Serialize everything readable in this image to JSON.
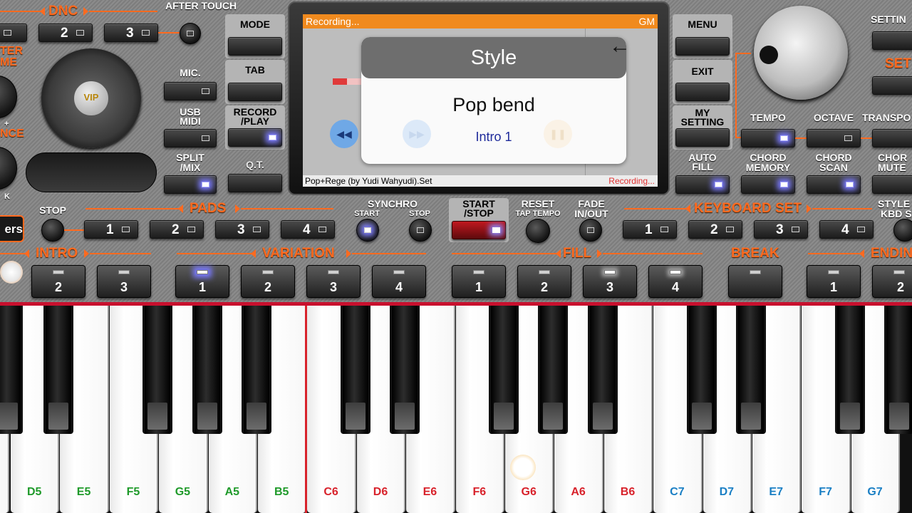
{
  "top_left": {
    "dnc_title": "DNC",
    "dnc_buttons": [
      "2",
      "3"
    ],
    "after_touch": "AFTER TOUCH",
    "side_orange_1": "TER",
    "side_orange_2": "ME",
    "side_orange_3": "NCE",
    "plus_sign": "+",
    "k_letter": "K",
    "vip_text": "VIP",
    "mic": "MIC.",
    "usb_midi_1": "USB",
    "usb_midi_2": "MIDI",
    "split_mix_1": "SPLIT",
    "split_mix_2": "/MIX",
    "ers_label": "ers"
  },
  "center_left_buttons": {
    "mode": "MODE",
    "tab": "TAB",
    "record_1": "RECORD",
    "record_2": "/PLAY",
    "qt": "Q.T."
  },
  "screen": {
    "status": "Recording...",
    "gm": "GM",
    "dialog_title": "Style",
    "style_name": "Pop bend",
    "section": "Intro 1",
    "bottom_file": "Pop+Rege (by Yudi Wahyudi).Set",
    "bottom_status": "Recording..."
  },
  "right_buttons": {
    "menu": "MENU",
    "exit": "EXIT",
    "my_setting_1": "MY",
    "my_setting_2": "SETTING",
    "auto_fill_1": "AUTO",
    "auto_fill_2": "FILL",
    "setting": "SETTIN",
    "set": "SET",
    "tempo": "TEMPO",
    "octave": "OCTAVE",
    "transpose": "TRANSPO",
    "chord_memory_1": "CHORD",
    "chord_memory_2": "MEMORY",
    "chord_scan_1": "CHORD",
    "chord_scan_2": "SCAN",
    "chord_mute_1": "CHOR",
    "chord_mute_2": "MUTE"
  },
  "middle_row": {
    "stop": "STOP",
    "pads": "PADS",
    "pads_buttons": [
      "1",
      "2",
      "3",
      "4"
    ],
    "synchro": "SYNCHRO",
    "synchro_start": "START",
    "synchro_stop": "STOP",
    "start_stop_1": "START",
    "start_stop_2": "/STOP",
    "reset": "RESET",
    "tap_tempo": "TAP TEMPO",
    "fade_1": "FADE",
    "fade_2": "IN/OUT",
    "keyboard_set": "KEYBOARD SET",
    "keyboard_set_buttons": [
      "1",
      "2",
      "3",
      "4"
    ],
    "style_kbd_1": "STYLE",
    "style_kbd_2": "KBD S"
  },
  "sections": {
    "intro": "INTRO",
    "intro_buttons": [
      "2",
      "3"
    ],
    "variation": "VARIATION",
    "variation_buttons": [
      "1",
      "2",
      "3",
      "4"
    ],
    "fill": "FILL",
    "fill_buttons": [
      "1",
      "2",
      "3",
      "4"
    ],
    "break": "BREAK",
    "ending": "ENDIN",
    "ending_buttons": [
      "1",
      "2"
    ]
  },
  "keyboard": {
    "white_keys": [
      {
        "note": "D5",
        "color": "#1f9a2a"
      },
      {
        "note": "E5",
        "color": "#1f9a2a"
      },
      {
        "note": "F5",
        "color": "#1f9a2a"
      },
      {
        "note": "G5",
        "color": "#1f9a2a"
      },
      {
        "note": "A5",
        "color": "#1f9a2a"
      },
      {
        "note": "B5",
        "color": "#1f9a2a"
      },
      {
        "note": "C6",
        "color": "#d8222b"
      },
      {
        "note": "D6",
        "color": "#d8222b"
      },
      {
        "note": "E6",
        "color": "#d8222b"
      },
      {
        "note": "F6",
        "color": "#d8222b"
      },
      {
        "note": "G6",
        "color": "#d8222b"
      },
      {
        "note": "A6",
        "color": "#d8222b"
      },
      {
        "note": "B6",
        "color": "#d8222b"
      },
      {
        "note": "C7",
        "color": "#1a7fc4"
      },
      {
        "note": "D7",
        "color": "#1a7fc4"
      },
      {
        "note": "E7",
        "color": "#1a7fc4"
      },
      {
        "note": "F7",
        "color": "#1a7fc4"
      },
      {
        "note": "G7",
        "color": "#1a7fc4"
      }
    ]
  }
}
